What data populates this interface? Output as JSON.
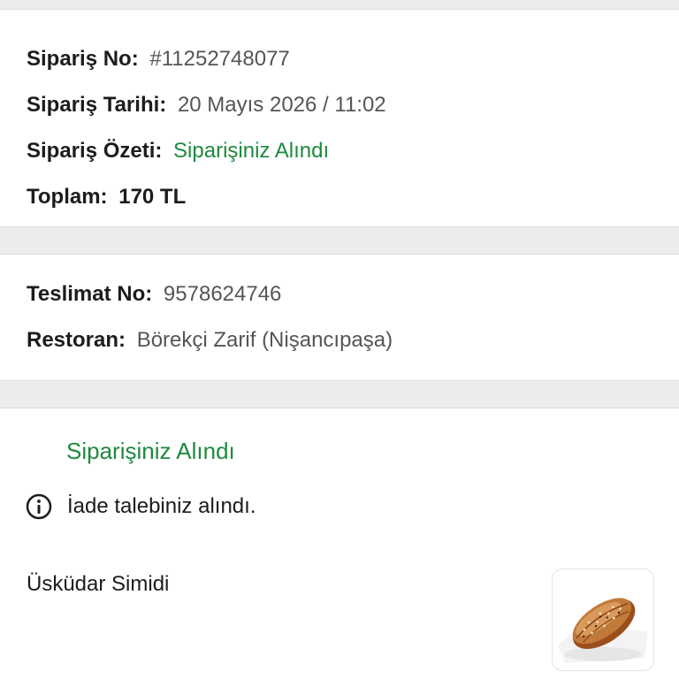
{
  "order": {
    "order_no_label": "Sipariş No:",
    "order_no_value": "#11252748077",
    "order_date_label": "Sipariş Tarihi:",
    "order_date_value": "20 Mayıs 2026 / 11:02",
    "order_summary_label": "Sipariş Özeti:",
    "order_summary_value": "Siparişiniz Alındı",
    "total_label": "Toplam:",
    "total_value": "170 TL"
  },
  "delivery": {
    "delivery_no_label": "Teslimat No:",
    "delivery_no_value": "9578624746",
    "restaurant_label": "Restoran:",
    "restaurant_value": "Börekçi Zarif (Nişancıpaşa)"
  },
  "status": {
    "title": "Siparişiniz Alındı",
    "refund_icon": "info-icon",
    "refund_text": "İade talebiniz alındı.",
    "product_name": "Üsküdar Simidi"
  },
  "colors": {
    "accent_green": "#1e8a3f",
    "background": "#ececec",
    "card": "#ffffff"
  }
}
